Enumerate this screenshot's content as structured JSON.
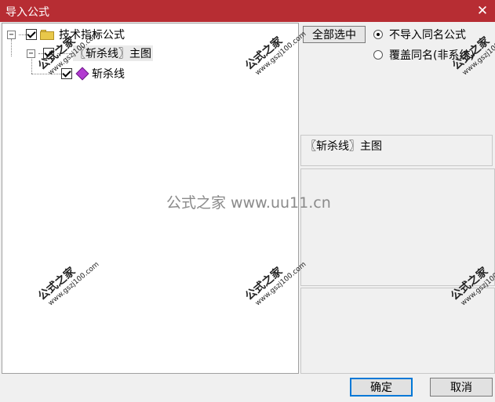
{
  "window": {
    "title": "导入公式",
    "close_glyph": "✕"
  },
  "tree": {
    "root": {
      "expander": "−",
      "label": "技术指标公式",
      "checked": true,
      "icon": "folder-icon"
    },
    "child": {
      "expander": "−",
      "label": "〖斩杀线〗主图",
      "checked": true
    },
    "leaf": {
      "label": "斩杀线",
      "checked": true,
      "icon": "formula-icon"
    }
  },
  "options": {
    "select_all": "全部选中",
    "radio_skip": "不导入同名公式",
    "radio_overwrite": "覆盖同名(非系统)",
    "radio_selected": "skip"
  },
  "info": {
    "formula_name": "〖斩杀线〗主图"
  },
  "buttons": {
    "ok": "确定",
    "cancel": "取消"
  },
  "watermarks": {
    "center": "公式之家 www.uu11.cn",
    "stamp_title": "公式之家",
    "stamp_url": "www.gszj100.com"
  }
}
